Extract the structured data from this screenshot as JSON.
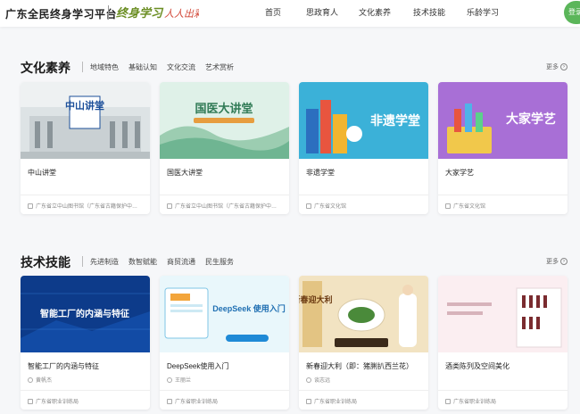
{
  "header": {
    "site_title": "广东全民终身学习平台",
    "slogan": "终身学习 人人出彩",
    "nav": [
      "首页",
      "思政育人",
      "文化素养",
      "技术技能",
      "乐龄学习"
    ],
    "login_label": "登录",
    "brand_color": "#5bb65a"
  },
  "sections": [
    {
      "title": "文化素养",
      "tags": [
        "地域特色",
        "基础认知",
        "文化交流",
        "艺术赏析"
      ],
      "more_label": "更多",
      "cards": [
        {
          "name": "中山讲堂",
          "meta": "广东省立中山图书馆（广东省古籍保护中…",
          "icon": "library-icon"
        },
        {
          "name": "国医大讲堂",
          "meta": "广东省立中山图书馆（广东省古籍保护中…",
          "icon": "library-icon"
        },
        {
          "name": "非遗学堂",
          "meta": "广东省文化馆",
          "icon": "library-icon"
        },
        {
          "name": "大家学艺",
          "meta": "广东省文化馆",
          "icon": "library-icon"
        }
      ],
      "banner_texts": [
        "中山讲堂",
        "国医大讲堂",
        "非遗学堂",
        "大家学艺"
      ]
    },
    {
      "title": "技术技能",
      "tags": [
        "先进制造",
        "数智赋能",
        "商贸流通",
        "民生服务"
      ],
      "more_label": "更多",
      "cards": [
        {
          "name": "智能工厂的内涵与特征",
          "teacher": "黄帆杰",
          "org": "广东省职业训练局"
        },
        {
          "name": "DeepSeek使用入门",
          "teacher": "王丽兰",
          "org": "广东省职业训练局"
        },
        {
          "name": "新春迎大利（即：猪脷扒西兰花）",
          "teacher": "谈志远",
          "org": "广东省职业训练局"
        },
        {
          "name": "酒类陈列及空间美化",
          "teacher": "",
          "org": "广东省职业训练局"
        }
      ],
      "banner_texts": [
        "智能工厂的内涵与特征",
        "DeepSeek 使用入门",
        "新春迎大利"
      ]
    }
  ]
}
